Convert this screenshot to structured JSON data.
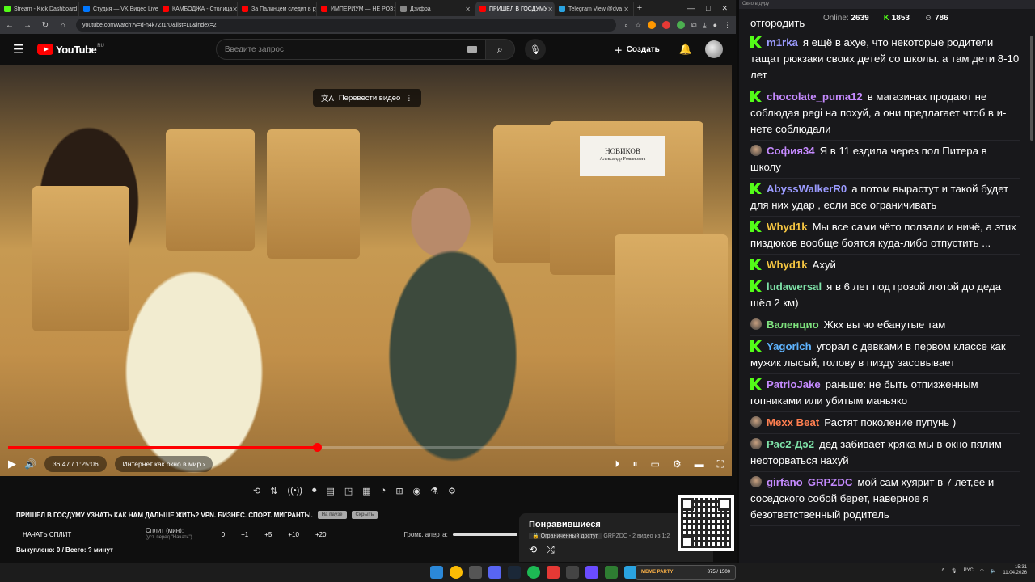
{
  "tabs": [
    {
      "label": "Stream - Kick Dashboard",
      "color": "#53fc18"
    },
    {
      "label": "Студия — VK Видео Live",
      "color": "#0077ff"
    },
    {
      "label": "КАМБОДЖА - Столица",
      "color": "#ff0000"
    },
    {
      "label": "За Палинцем следит в ру",
      "color": "#ff0000"
    },
    {
      "label": "ИМПЕРИУМ — НЕ РОЗ",
      "color": "#ff0000"
    },
    {
      "label": "Дзифра",
      "color": "#888888"
    },
    {
      "label": "ПРИШЕЛ В ГОСДУМУ",
      "color": "#ff0000",
      "active": true
    },
    {
      "label": "Telegram View @dva",
      "color": "#2aa3e0"
    }
  ],
  "url": "youtube.com/watch?v=d-h4k7Zr1rU&list=LL&index=2",
  "header": {
    "logo": "YouTube",
    "region": "RU",
    "search_placeholder": "Введите запрос",
    "create_label": "Создать"
  },
  "video": {
    "translate_label": "Перевести видео",
    "nameplate_name": "НОВИКОВ",
    "nameplate_sub": "Александр Романович",
    "time": "36:47 / 1:25:06",
    "chapter": "Интернет как окно в мир",
    "progress_pct": 43.2
  },
  "below": {
    "title": "ПРИШЕЛ В ГОСДУМУ УЗНАТЬ КАК НАМ ДАЛЬШЕ ЖИТЬ? VPN. БИЗНЕС. СПОРТ. МИГРАНТЫ.",
    "tag1": "На паузе",
    "tag2": "Скрыть",
    "split_label": "НАЧАТЬ СПЛИТ",
    "split_min": "Сплит (мин):",
    "split_min_sub": "(уст. перед \"Начать\")",
    "split_values": [
      "0",
      "+1",
      "+5",
      "+10",
      "+20"
    ],
    "alert_label": "Громк. алерта:",
    "bought": "Выкуплено: 0 / Всего: ? минут",
    "playlist_title": "Понравившиеся",
    "playlist_badge": "Ограниченный доступ",
    "playlist_meta": "GRPZDC - 2 видео из 1:2"
  },
  "chat": {
    "window_title": "Окно в дуру",
    "online_label": "Online:",
    "online": "2639",
    "kick_count": "1853",
    "other_count": "786",
    "partial_top": "отгородить",
    "messages": [
      {
        "user": "m1rka",
        "color": "#9b9bff",
        "badge": "k",
        "text": "я ещё в ахуе, что некоторые родители тащат рюкзаки своих детей со школы. а там дети 8-10 лет"
      },
      {
        "user": "chocolate_puma12",
        "color": "#c58aff",
        "badge": "k",
        "text": "в магазинах продают не соблюдая pegi на похуй, а они предлагает чтоб в и-нете соблюдали"
      },
      {
        "user": "София34",
        "color": "#c58aff",
        "badge": "av",
        "text": "Я в 11 ездила через пол Питера в школу"
      },
      {
        "user": "AbyssWalkerR0",
        "color": "#9b9bff",
        "badge": "k",
        "text": "а потом вырастут и такой будет для них удар , если все ограничивать"
      },
      {
        "user": "Whyd1k",
        "color": "#f5c542",
        "badge": "k",
        "text": "Мы все сами чёто ползали и ничё, а этих пиздюков вообще боятся куда-либо отпустить ..."
      },
      {
        "user": "Whyd1k",
        "color": "#f5c542",
        "badge": "k",
        "text": "Ахуй"
      },
      {
        "user": "ludawersal",
        "color": "#7ee2a8",
        "badge": "k",
        "text": "я в 6 лет под грозой лютой до деда шёл 2 км)"
      },
      {
        "user": "Валенцио",
        "color": "#7ee27e",
        "badge": "av",
        "text": "Жкх вы чо ебанутые там"
      },
      {
        "user": "Yagorich",
        "color": "#5fb4ff",
        "badge": "k",
        "text": "угорал с девками в первом классе как мужик лысый, голову в пизду засовывает"
      },
      {
        "user": "PatrioJake",
        "color": "#c58aff",
        "badge": "k",
        "text": "раньше: не быть отпизженным гопниками или убитым маньяко"
      },
      {
        "user": "Mexx Beat",
        "color": "#ff7f50",
        "badge": "av",
        "text": "Растят поколение пупунь )"
      },
      {
        "user": "Рас2-Дэ2",
        "color": "#7ee2a8",
        "badge": "av",
        "text": "дед забивает хряка мы в окно пялим - неоторваться нахуй"
      },
      {
        "user": "girfano",
        "color": "#c58aff",
        "badge": "av",
        "user2": "GRPZDC",
        "text": "мой сам хуярит  в 7 лет,ее и соседского собой берет, наверное я безответственный родитель"
      }
    ]
  },
  "taskbar": {
    "meme_label": "MEME PARTY",
    "meme_count": "875 / 1500",
    "lang": "РУС",
    "time": "15:31",
    "date": "11.04.2026"
  }
}
